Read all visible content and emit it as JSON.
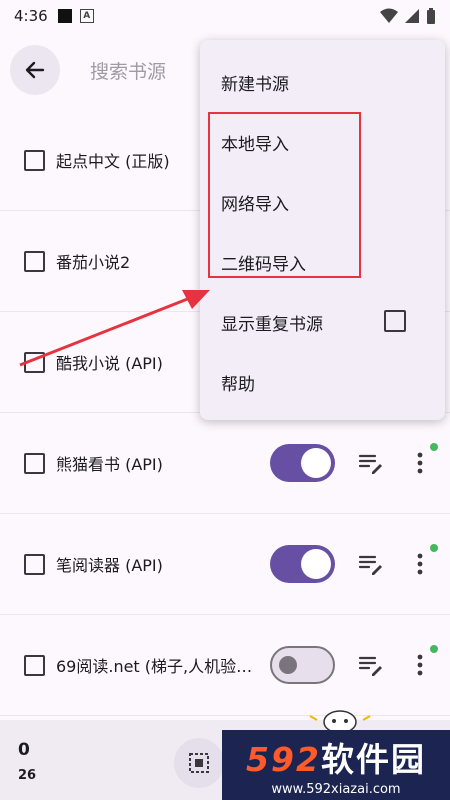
{
  "status_bar": {
    "time": "4:36"
  },
  "header": {
    "title": "搜索书源"
  },
  "sources": [
    {
      "label": "起点中文 (正版)",
      "toggle": null
    },
    {
      "label": "番茄小说2",
      "toggle": null
    },
    {
      "label": "酷我小说 (API)",
      "toggle": null
    },
    {
      "label": "熊猫看书 (API)",
      "toggle": "on"
    },
    {
      "label": "笔阅读器 (API)",
      "toggle": "on"
    },
    {
      "label": "69阅读.net (梯子,人机验…",
      "toggle": "off"
    }
  ],
  "menu": {
    "items": [
      "新建书源",
      "本地导入",
      "网络导入",
      "二维码导入",
      "显示重复书源",
      "帮助"
    ]
  },
  "bottom": {
    "selected": "0",
    "total": "26"
  },
  "watermark": {
    "brand_num": "592",
    "brand_text": "软件园",
    "url": "www.592xiazai.com"
  },
  "colors": {
    "accent": "#6750a4",
    "highlight": "#e5343f",
    "online_dot": "#43b85c"
  }
}
